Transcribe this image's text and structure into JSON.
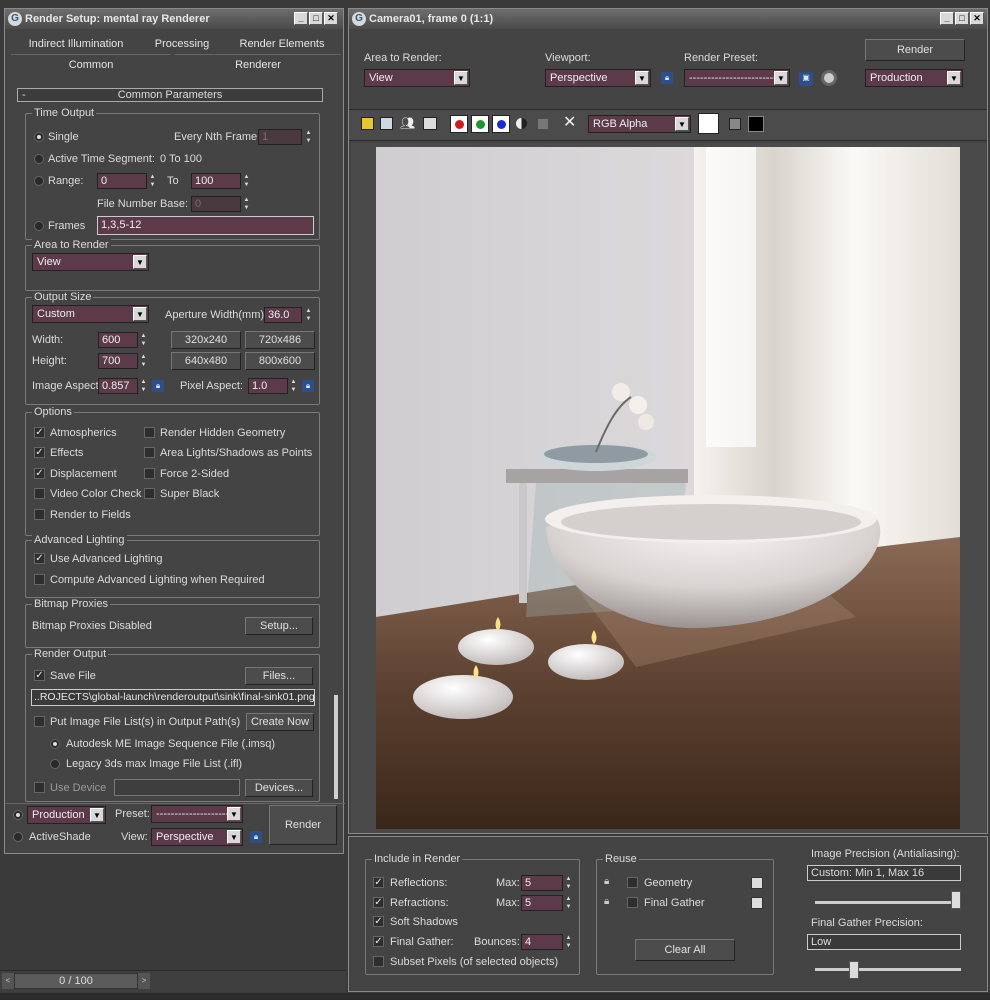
{
  "render_setup": {
    "title": "Render Setup: mental ray Renderer",
    "tabs": [
      "Indirect Illumination",
      "Processing",
      "Render Elements",
      "Common",
      "Renderer"
    ],
    "rollout_title": "Common Parameters",
    "time_output": {
      "label": "Time Output",
      "single": "Single",
      "every_nth": "Every Nth Frame:",
      "every_nth_value": "1",
      "active_segment": "Active Time Segment:",
      "active_segment_value": "0 To 100",
      "range": "Range:",
      "range_from": "0",
      "range_to_label": "To",
      "range_to": "100",
      "file_number_base": "File Number Base:",
      "file_number_base_value": "0",
      "frames": "Frames",
      "frames_value": "1,3,5-12"
    },
    "area_to_render": {
      "label": "Area to Render",
      "value": "View"
    },
    "output_size": {
      "label": "Output Size",
      "preset": "Custom",
      "aperture_label": "Aperture Width(mm):",
      "aperture_value": "36.0",
      "width_label": "Width:",
      "width_value": "600",
      "height_label": "Height:",
      "height_value": "700",
      "presets": [
        "320x240",
        "720x486",
        "640x480",
        "800x600"
      ],
      "image_aspect_label": "Image Aspect:",
      "image_aspect_value": "0.857",
      "pixel_aspect_label": "Pixel Aspect:",
      "pixel_aspect_value": "1.0"
    },
    "options": {
      "label": "Options",
      "items": [
        {
          "label": "Atmospherics",
          "checked": true
        },
        {
          "label": "Render Hidden Geometry",
          "checked": false
        },
        {
          "label": "Effects",
          "checked": true
        },
        {
          "label": "Area Lights/Shadows as Points",
          "checked": false
        },
        {
          "label": "Displacement",
          "checked": true
        },
        {
          "label": "Force 2-Sided",
          "checked": false
        },
        {
          "label": "Video Color Check",
          "checked": false
        },
        {
          "label": "Super Black",
          "checked": false
        },
        {
          "label": "Render to Fields",
          "checked": false
        }
      ]
    },
    "advanced_lighting": {
      "label": "Advanced Lighting",
      "use": "Use Advanced Lighting",
      "compute": "Compute Advanced Lighting when Required"
    },
    "bitmap_proxies": {
      "label": "Bitmap Proxies",
      "status": "Bitmap Proxies Disabled",
      "setup": "Setup..."
    },
    "render_output": {
      "label": "Render Output",
      "save_file": "Save File",
      "files": "Files...",
      "path": "..ROJECTS\\global-launch\\renderoutput\\sink\\final-sink01.png",
      "put_list": "Put Image File List(s) in Output Path(s)",
      "create_now": "Create Now",
      "autodesk": "Autodesk ME Image Sequence File (.imsq)",
      "legacy": "Legacy 3ds max Image File List (.ifl)",
      "use_device": "Use Device",
      "devices": "Devices..."
    },
    "bottom": {
      "production": "Production",
      "activeshade": "ActiveShade",
      "preset_label": "Preset:",
      "preset_value": "---------------------",
      "view_label": "View:",
      "view_value": "Perspective",
      "render": "Render"
    }
  },
  "frame_window": {
    "title": "Camera01, frame 0 (1:1)",
    "area_label": "Area to Render:",
    "area_value": "View",
    "viewport_label": "Viewport:",
    "viewport_value": "Perspective",
    "preset_label": "Render Preset:",
    "preset_value": "-------------------------",
    "render": "Render",
    "production": "Production",
    "channel": "RGB Alpha",
    "include": {
      "label": "Include in Render",
      "reflections": "Reflections:",
      "refractions": "Refractions:",
      "soft_shadows": "Soft Shadows",
      "final_gather": "Final Gather:",
      "subset": "Subset Pixels (of selected objects)",
      "max_label": "Max:",
      "max_reflections": "5",
      "max_refractions": "5",
      "bounces_label": "Bounces:",
      "bounces_value": "4"
    },
    "reuse": {
      "label": "Reuse",
      "geometry": "Geometry",
      "final_gather": "Final Gather",
      "clear_all": "Clear All"
    },
    "precision": {
      "label": "Image Precision (Antialiasing):",
      "value": "Custom: Min 1, Max 16",
      "slider": 1.0,
      "fg_label": "Final Gather Precision:",
      "fg_value": "Low",
      "fg_slider": 0.25
    }
  },
  "timeline": {
    "frame": "0 / 100"
  }
}
